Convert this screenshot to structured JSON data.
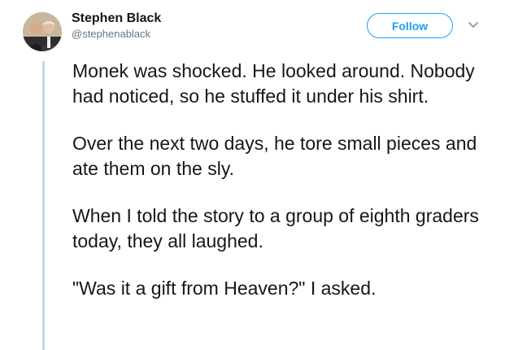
{
  "tweet": {
    "author": {
      "display_name": "Stephen Black",
      "handle": "@stephenablack"
    },
    "follow_label": "Follow",
    "paragraphs": [
      "Monek was shocked. He looked around. Nobody had noticed, so he stuffed it under his shirt.",
      "Over the next two days, he tore small pieces and ate them on the sly.",
      "When I told the story to a group of eighth graders today, they all laughed.",
      "\"Was it a gift from Heaven?\" I asked."
    ]
  },
  "colors": {
    "accent": "#1da1f2",
    "thread_line": "#c4d9e7",
    "text": "#14171a",
    "muted": "#657786"
  },
  "icons": {
    "avatar": "profile-photo",
    "menu": "chevron-down-icon"
  }
}
